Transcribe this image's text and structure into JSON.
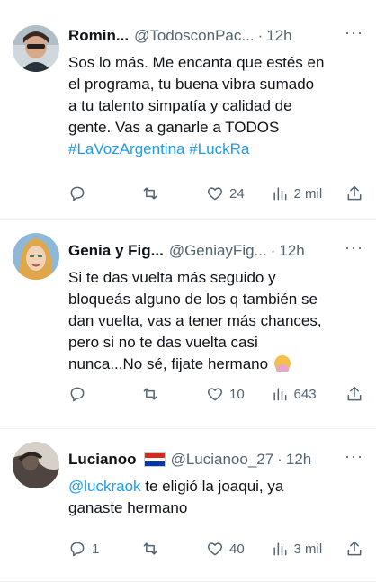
{
  "tweets": [
    {
      "name": "Romin...",
      "handle": "@TodosconPac...",
      "dot": "·",
      "time": "12h",
      "more": "···",
      "lines": [
        "Sos lo más. Me encanta que estés en",
        "el programa, tu buena vibra sumado",
        "a tu talento simpatía y calidad de",
        "gente. Vas a ganarle a TODOS"
      ],
      "hashtags": [
        "#LaVozArgentina",
        "#LuckRa"
      ],
      "replies": "",
      "retweets": "",
      "likes": "24",
      "views": "2 mil"
    },
    {
      "name": "Genia y Fig...",
      "handle": "@GeniayFig...",
      "dot": "·",
      "time": "12h",
      "more": "···",
      "lines": [
        "Si te das vuelta más seguido y",
        "bloqueás alguno de los q también se",
        "dan vuelta, vas a tener más chances,",
        "pero si no te das vuelta casi",
        "nunca...No sé, fijate hermano"
      ],
      "emoji": "woman-shrugging-emoji",
      "replies": "",
      "retweets": "",
      "likes": "10",
      "views": "643"
    },
    {
      "name": "Lucianoo",
      "flag": "paraguay-flag",
      "handle": "@Lucianoo_27",
      "dot": "·",
      "time": "12h",
      "more": "···",
      "mention": "@luckraok",
      "line1_rest": " te eligió la joaqui, ya",
      "line2": "ganaste hermano",
      "replies": "1",
      "retweets": "",
      "likes": "40",
      "views": "3 mil"
    }
  ],
  "colors": {
    "text": "#0f1419",
    "secondary": "#536471",
    "link": "#1d9bf0",
    "divider": "#eff3f4"
  }
}
